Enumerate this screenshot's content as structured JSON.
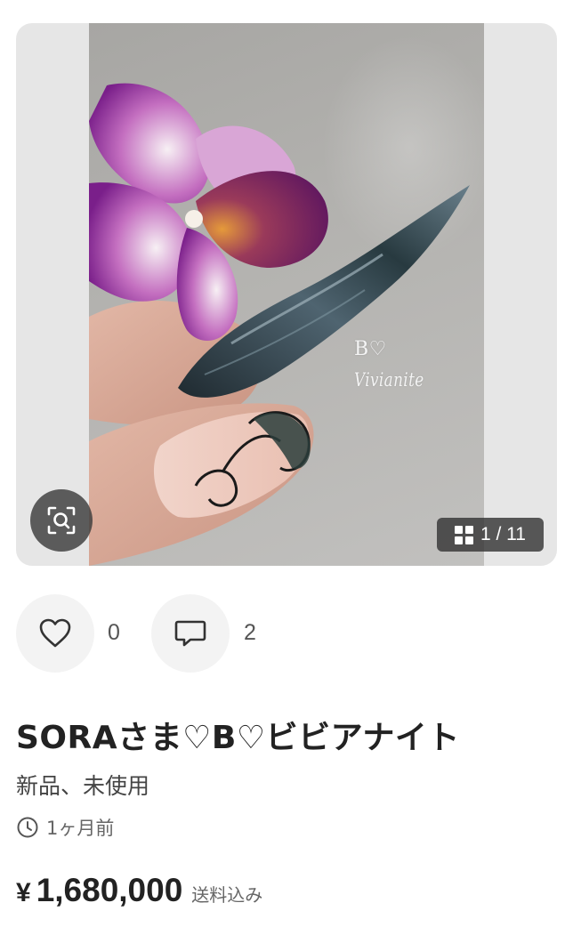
{
  "gallery": {
    "watermark_line1": "B♡",
    "watermark_line2": "Vivianite",
    "counter": "1 / 11",
    "icons": {
      "lens": "image-search-icon",
      "counter": "grid-icon"
    }
  },
  "actions": {
    "like_icon": "heart-outline-icon",
    "like_count": "0",
    "comment_icon": "speech-bubble-icon",
    "comment_count": "2"
  },
  "item": {
    "title": "SORAさま♡B♡ビビアナイト",
    "condition": "新品、未使用",
    "posted_icon": "clock-icon",
    "posted": "1ヶ月前",
    "price_currency": "¥",
    "price_amount": "1,680,000",
    "shipping_note": "送料込み"
  },
  "colors": {
    "background": "#ffffff",
    "text_primary": "#222222",
    "text_secondary": "#666666",
    "action_bg": "#f3f3f3",
    "overlay_dark": "#3c3c3c"
  }
}
